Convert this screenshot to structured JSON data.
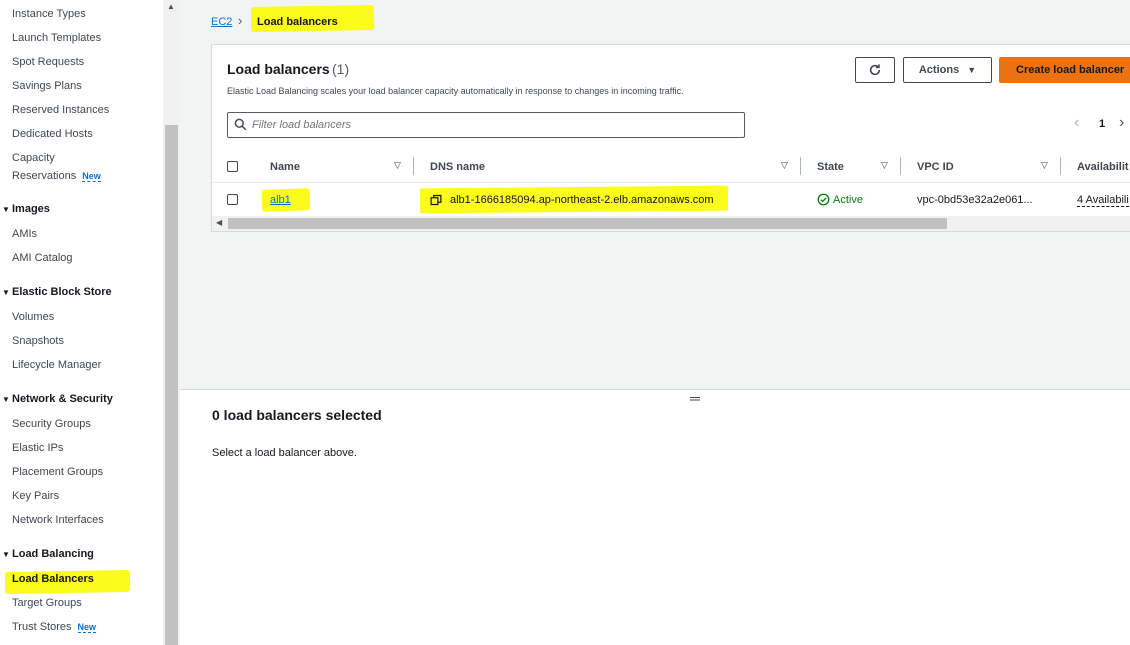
{
  "sidebar": {
    "items": [
      {
        "label": "Instance Types"
      },
      {
        "label": "Launch Templates"
      },
      {
        "label": "Spot Requests"
      },
      {
        "label": "Savings Plans"
      },
      {
        "label": "Reserved Instances"
      },
      {
        "label": "Dedicated Hosts"
      },
      {
        "label": "Capacity"
      },
      {
        "label": "Reservations"
      }
    ],
    "new_badge": "New",
    "images": {
      "heading": "Images",
      "items": [
        "AMIs",
        "AMI Catalog"
      ]
    },
    "ebs": {
      "heading": "Elastic Block Store",
      "items": [
        "Volumes",
        "Snapshots",
        "Lifecycle Manager"
      ]
    },
    "network": {
      "heading": "Network & Security",
      "items": [
        "Security Groups",
        "Elastic IPs",
        "Placement Groups",
        "Key Pairs",
        "Network Interfaces"
      ]
    },
    "lb": {
      "heading": "Load Balancing",
      "items": [
        "Load Balancers",
        "Target Groups",
        "Trust Stores"
      ]
    }
  },
  "breadcrumb": {
    "root": "EC2",
    "current": "Load balancers"
  },
  "panel": {
    "title": "Load balancers",
    "count": "(1)",
    "description": "Elastic Load Balancing scales your load balancer capacity automatically in response to changes in incoming traffic.",
    "actions_label": "Actions",
    "create_label": "Create load balancer",
    "filter_placeholder": "Filter load balancers",
    "page": "1"
  },
  "table": {
    "headers": {
      "name": "Name",
      "dns": "DNS name",
      "state": "State",
      "vpc": "VPC ID",
      "az": "Availabilit"
    },
    "rows": [
      {
        "name": "alb1",
        "dns": "alb1-1666185094.ap-northeast-2.elb.amazonaws.com",
        "state": "Active",
        "vpc": "vpc-0bd53e32a2e061...",
        "az": "4 Availabili"
      }
    ]
  },
  "detail": {
    "title": "0 load balancers selected",
    "description": "Select a load balancer above."
  },
  "colors": {
    "accent": "#0972d3",
    "primary_button": "#ec7211",
    "highlight": "#fbfb1c",
    "success": "#037f0c"
  }
}
